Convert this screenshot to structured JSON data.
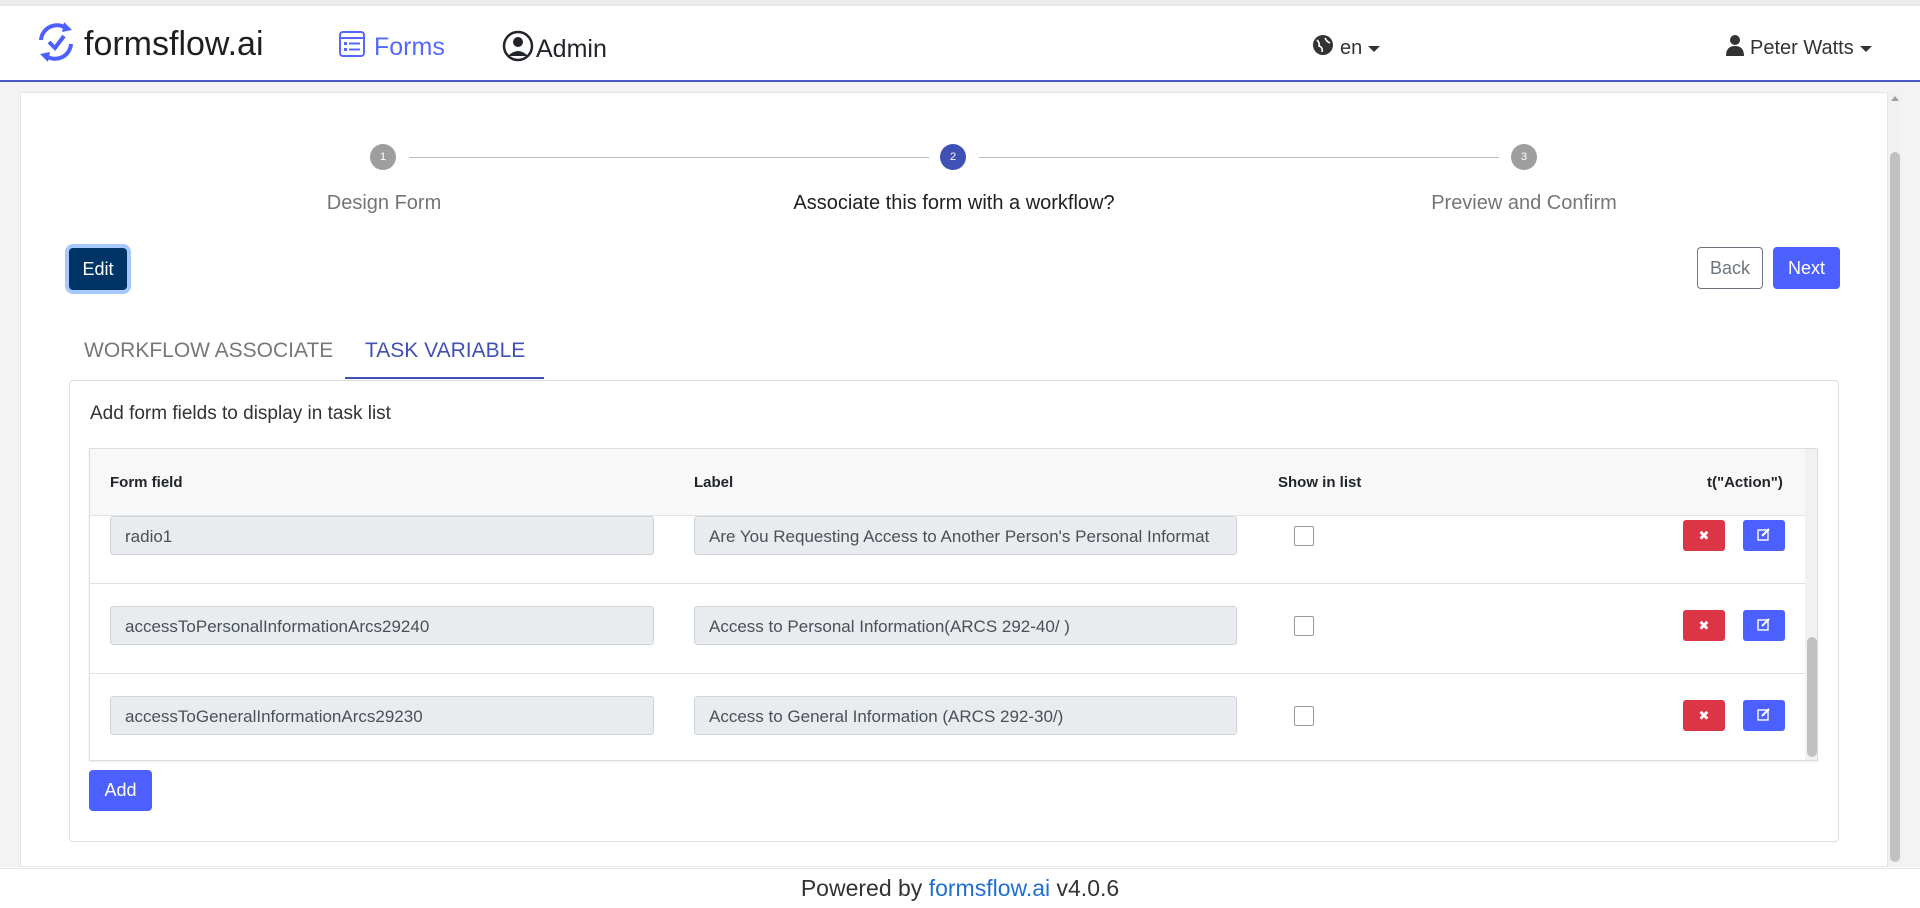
{
  "header": {
    "brand": "formsflow.ai",
    "nav_forms": "Forms",
    "nav_admin": "Admin",
    "language": "en",
    "user": "Peter Watts",
    "accent": "#4a5bc7"
  },
  "stepper": {
    "steps": [
      {
        "number": "1",
        "label": "Design Form"
      },
      {
        "number": "2",
        "label": "Associate this form with a workflow?"
      },
      {
        "number": "3",
        "label": "Preview and Confirm"
      }
    ],
    "active_step": 2
  },
  "buttons": {
    "edit": "Edit",
    "back": "Back",
    "next": "Next",
    "add": "Add"
  },
  "tabs": [
    {
      "label": "WORKFLOW ASSOCIATE",
      "active": false
    },
    {
      "label": "TASK VARIABLE",
      "active": true
    }
  ],
  "panel": {
    "title": "Add form fields to display in task list"
  },
  "table": {
    "headers": {
      "form_field": "Form field",
      "label": "Label",
      "show_in_list": "Show in list",
      "action": "t(\"Action\")"
    },
    "rows": [
      {
        "form_field": "radio1",
        "label": "Are You Requesting Access to Another Person's Personal Informat",
        "show_in_list": false
      },
      {
        "form_field": "accessToPersonalInformationArcs29240",
        "label": "Access to  Personal Information(ARCS 292-40/ )",
        "show_in_list": false
      },
      {
        "form_field": "accessToGeneralInformationArcs29230",
        "label": "Access to General Information (ARCS 292-30/)",
        "show_in_list": false
      }
    ]
  },
  "footer": {
    "prefix": "Powered by ",
    "link": "formsflow.ai",
    "version": " v4.0.6"
  },
  "icons": {
    "logo": "refresh-check-icon",
    "forms": "list-form-icon",
    "admin": "user-circle-icon",
    "lang": "globe-icon",
    "user": "user-icon",
    "delete": "close-icon",
    "edit": "edit-icon"
  }
}
